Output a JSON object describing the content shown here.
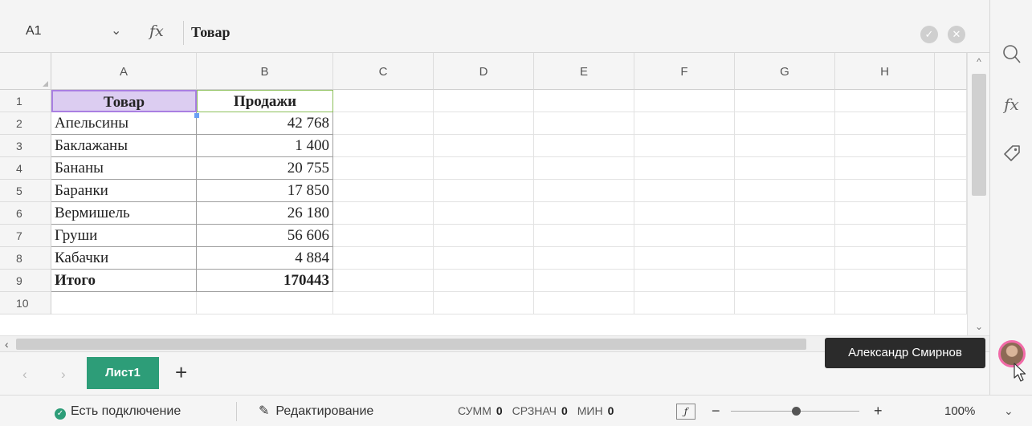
{
  "formula_bar": {
    "cell_ref": "A1",
    "fx_label": "fx",
    "formula": "Товар"
  },
  "columns": [
    "A",
    "B",
    "C",
    "D",
    "E",
    "F",
    "G",
    "H"
  ],
  "rows": [
    "1",
    "2",
    "3",
    "4",
    "5",
    "6",
    "7",
    "8",
    "9",
    "10"
  ],
  "table": {
    "header": [
      "Товар",
      "Продажи"
    ],
    "items": [
      {
        "name": "Апельсины",
        "value": "42 768"
      },
      {
        "name": "Баклажаны",
        "value": "1 400"
      },
      {
        "name": "Бананы",
        "value": "20 755"
      },
      {
        "name": "Баранки",
        "value": "17 850"
      },
      {
        "name": "Вермишель",
        "value": "26 180"
      },
      {
        "name": "Груши",
        "value": "56 606"
      },
      {
        "name": "Кабачки",
        "value": "4 884"
      }
    ],
    "total": {
      "name": "Итого",
      "value": "170443"
    }
  },
  "sheets": {
    "active": "Лист1",
    "add_label": "+"
  },
  "tooltip": "Александр Смирнов",
  "status": {
    "connection": "Есть подключение",
    "mode": "Редактирование",
    "sum_label": "СУММ",
    "sum_value": "0",
    "avg_label": "СРЗНАЧ",
    "avg_value": "0",
    "min_label": "МИН",
    "min_value": "0",
    "zoom": "100%"
  },
  "icons": {
    "search": "search-icon",
    "function": "function-icon",
    "tag": "tag-icon",
    "avatar": "avatar-icon",
    "connection": "check-circle-icon",
    "edit": "pencil-icon"
  },
  "colors": {
    "accent": "#2d9d78",
    "selection_fill": "#dccdf1",
    "selection_border": "#a97fe2",
    "avatar_ring": "#f26aa8"
  }
}
